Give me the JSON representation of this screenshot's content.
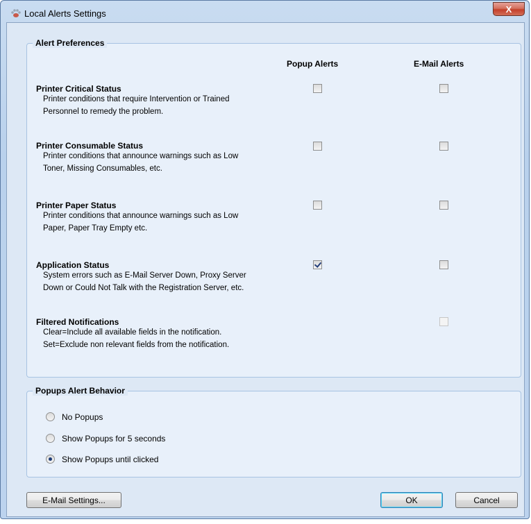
{
  "window": {
    "title": "Local Alerts Settings",
    "close_label": "X",
    "app_icon": "paw-icon"
  },
  "alert_preferences": {
    "group_title": "Alert Preferences",
    "col_popup": "Popup Alerts",
    "col_email": "E-Mail Alerts",
    "rows": [
      {
        "title": "Printer Critical Status",
        "desc1": "Printer conditions that require Intervention or Trained",
        "desc2": "Personnel to remedy the problem.",
        "popup_checked": false,
        "email_checked": false
      },
      {
        "title": "Printer Consumable Status",
        "desc1": "Printer conditions that announce warnings such as Low",
        "desc2": "Toner, Missing Consumables, etc.",
        "popup_checked": false,
        "email_checked": false
      },
      {
        "title": "Printer Paper Status",
        "desc1": "Printer conditions that announce warnings such as Low",
        "desc2": "Paper, Paper Tray Empty etc.",
        "popup_checked": false,
        "email_checked": false
      },
      {
        "title": "Application Status",
        "desc1": "System errors such as E-Mail Server Down, Proxy Server",
        "desc2": "Down or Could Not Talk with the Registration Server, etc.",
        "popup_checked": true,
        "email_checked": false
      },
      {
        "title": "Filtered Notifications",
        "desc1": "Clear=Include all available fields in the notification.",
        "desc2": "Set=Exclude non relevant fields from the notification.",
        "email_checked": false,
        "email_disabled": true
      }
    ]
  },
  "popup_behavior": {
    "group_title": "Popups Alert Behavior",
    "options": [
      {
        "label": "No Popups",
        "selected": false
      },
      {
        "label": "Show Popups for 5 seconds",
        "selected": false
      },
      {
        "label": "Show Popups until clicked",
        "selected": true
      }
    ]
  },
  "buttons": {
    "email_settings": "E-Mail Settings...",
    "ok": "OK",
    "cancel": "Cancel"
  }
}
